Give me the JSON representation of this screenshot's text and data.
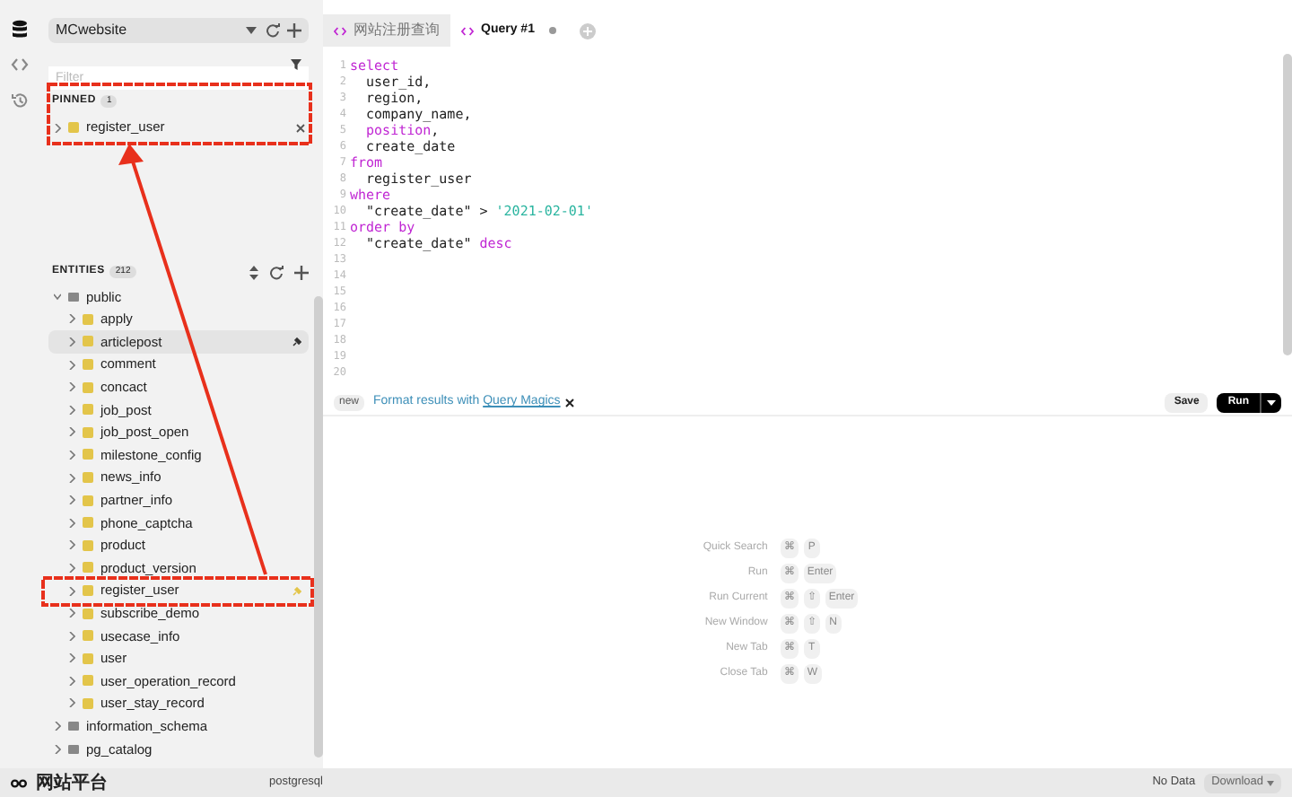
{
  "rail": [
    {
      "kind": "database",
      "selected": true
    },
    {
      "kind": "code",
      "selected": false
    },
    {
      "kind": "history",
      "selected": false
    }
  ],
  "connection": {
    "value": "MCwebsite"
  },
  "filter": {
    "placeholder": "Filter"
  },
  "pinned": {
    "title": "PINNED",
    "count": "1",
    "items": [
      {
        "name": "register_user"
      }
    ]
  },
  "entities": {
    "title": "ENTITIES",
    "count": "212",
    "schemas": [
      {
        "name": "public",
        "expanded": true,
        "children": [
          {
            "name": "apply",
            "highlighted": false,
            "pinned": false
          },
          {
            "name": "articlepost",
            "highlighted": true,
            "pinned": false
          },
          {
            "name": "comment",
            "highlighted": false,
            "pinned": false
          },
          {
            "name": "concact",
            "highlighted": false,
            "pinned": false
          },
          {
            "name": "job_post",
            "highlighted": false,
            "pinned": false
          },
          {
            "name": "job_post_open",
            "highlighted": false,
            "pinned": false
          },
          {
            "name": "milestone_config",
            "highlighted": false,
            "pinned": false
          },
          {
            "name": "news_info",
            "highlighted": false,
            "pinned": false
          },
          {
            "name": "partner_info",
            "highlighted": false,
            "pinned": false
          },
          {
            "name": "phone_captcha",
            "highlighted": false,
            "pinned": false
          },
          {
            "name": "product",
            "highlighted": false,
            "pinned": false
          },
          {
            "name": "product_version",
            "highlighted": false,
            "pinned": false
          },
          {
            "name": "register_user",
            "highlighted": false,
            "pinned": true
          },
          {
            "name": "subscribe_demo",
            "highlighted": false,
            "pinned": false
          },
          {
            "name": "usecase_info",
            "highlighted": false,
            "pinned": false
          },
          {
            "name": "user",
            "highlighted": false,
            "pinned": false
          },
          {
            "name": "user_operation_record",
            "highlighted": false,
            "pinned": false
          },
          {
            "name": "user_stay_record",
            "highlighted": false,
            "pinned": false
          }
        ]
      },
      {
        "name": "information_schema",
        "expanded": false
      },
      {
        "name": "pg_catalog",
        "expanded": false
      }
    ]
  },
  "tabs": [
    {
      "label": "网站注册查询",
      "selected": false,
      "unsaved": false
    },
    {
      "label": "Query #1",
      "selected": true,
      "unsaved": true
    }
  ],
  "editor": {
    "lines": [
      {
        "number": "1",
        "tokens": [
          {
            "kind": "keyword",
            "text": "select"
          }
        ]
      },
      {
        "number": "2",
        "tokens": [
          {
            "kind": "plain",
            "text": "  user_id,"
          }
        ]
      },
      {
        "number": "3",
        "tokens": [
          {
            "kind": "plain",
            "text": "  region,"
          }
        ]
      },
      {
        "number": "4",
        "tokens": [
          {
            "kind": "plain",
            "text": "  company_name,"
          }
        ]
      },
      {
        "number": "5",
        "tokens": [
          {
            "kind": "keyword",
            "text": "  position"
          },
          {
            "kind": "plain",
            "text": ","
          }
        ]
      },
      {
        "number": "6",
        "tokens": [
          {
            "kind": "plain",
            "text": "  create_date"
          }
        ]
      },
      {
        "number": "7",
        "tokens": [
          {
            "kind": "keyword",
            "text": "from"
          }
        ]
      },
      {
        "number": "8",
        "tokens": [
          {
            "kind": "plain",
            "text": "  register_user"
          }
        ]
      },
      {
        "number": "9",
        "tokens": [
          {
            "kind": "keyword",
            "text": "where"
          }
        ]
      },
      {
        "number": "10",
        "tokens": [
          {
            "kind": "plain",
            "text": "  \"create_date\" > "
          },
          {
            "kind": "string",
            "text": "'2021-02-01'"
          }
        ]
      },
      {
        "number": "11",
        "tokens": [
          {
            "kind": "keyword",
            "text": "order by"
          }
        ]
      },
      {
        "number": "12",
        "tokens": [
          {
            "kind": "plain",
            "text": "  \"create_date\" "
          },
          {
            "kind": "keyword",
            "text": "desc"
          }
        ]
      },
      {
        "number": "13"
      },
      {
        "number": "14"
      },
      {
        "number": "15"
      },
      {
        "number": "16"
      },
      {
        "number": "17"
      },
      {
        "number": "18"
      },
      {
        "number": "19"
      },
      {
        "number": "20"
      }
    ]
  },
  "banner": {
    "badge": "new",
    "text": "Format results with ",
    "link": "Query Magics"
  },
  "buttons": {
    "save": "Save",
    "run": "Run"
  },
  "shortcuts": [
    {
      "label": "Quick Search",
      "keys": [
        "⌘",
        "P"
      ]
    },
    {
      "label": "Run",
      "keys": [
        "⌘",
        "Enter"
      ]
    },
    {
      "label": "Run Current",
      "keys": [
        "⌘",
        "⇧",
        "Enter"
      ]
    },
    {
      "label": "New Window",
      "keys": [
        "⌘",
        "⇧",
        "N"
      ]
    },
    {
      "label": "New Tab",
      "keys": [
        "⌘",
        "T"
      ]
    },
    {
      "label": "Close Tab",
      "keys": [
        "⌘",
        "W"
      ]
    }
  ],
  "status_bar": {
    "workspace": "网站平台",
    "connection": "postgresql",
    "result": "No Data",
    "download": "Download"
  },
  "annotations": [
    {
      "kind": "box"
    },
    {
      "kind": "box"
    },
    {
      "kind": "arrow"
    }
  ]
}
